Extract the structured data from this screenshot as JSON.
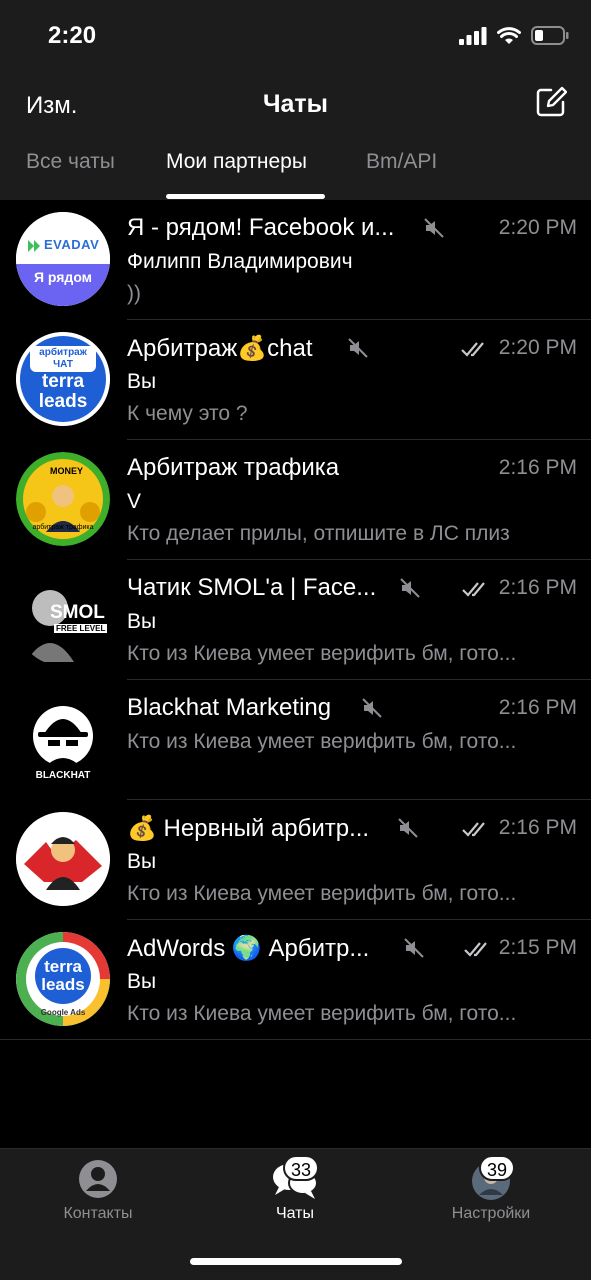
{
  "status": {
    "time": "2:20"
  },
  "nav": {
    "edit": "Изм.",
    "title": "Чаты"
  },
  "tabs": [
    {
      "label": "Все чаты"
    },
    {
      "label": "Мои партнеры"
    },
    {
      "label": "Bm/API"
    }
  ],
  "chats": [
    {
      "title": "Я - рядом! Facebook и...",
      "muted": true,
      "read": false,
      "time": "2:20 PM",
      "sender": "Филипп Владимирович",
      "message": "))",
      "avatar": {
        "text1": "EVADAV",
        "text2": "Я рядом"
      }
    },
    {
      "title": "Арбитраж💰chat",
      "muted": true,
      "read": true,
      "time": "2:20 PM",
      "sender": "Вы",
      "message": "К чему это ?",
      "avatar": {
        "text1": "арбитраж ЧАТ",
        "text2": "terra leads"
      }
    },
    {
      "title": "Арбитраж трафика",
      "muted": false,
      "read": false,
      "time": "2:16 PM",
      "sender": "V",
      "message": "Кто делает прилы, отпишите в ЛС плиз",
      "avatar": {
        "text1": "MONEY",
        "text2": "арбитраж трафика"
      }
    },
    {
      "title": "Чатик SMOL'a | Face...",
      "muted": true,
      "read": true,
      "time": "2:16 PM",
      "sender": "Вы",
      "message": "Кто из Киева умеет верифить бм, гото...",
      "avatar": {
        "text1": "SMOL",
        "text2": "FREE LEVEL"
      }
    },
    {
      "title": "Blackhat Marketing",
      "muted": true,
      "read": false,
      "time": "2:16 PM",
      "sender": "",
      "message": "Кто из Киева умеет верифить бм, гото...",
      "avatar": {
        "text1": "BLACKHAT",
        "text2": ""
      }
    },
    {
      "title": "💰 Нервный арбитр...",
      "muted": true,
      "read": true,
      "time": "2:16 PM",
      "sender": "Вы",
      "message": "Кто из Киева умеет верифить бм, гото...",
      "avatar": {
        "text1": "",
        "text2": ""
      }
    },
    {
      "title": "AdWords 🌍 Арбитр...",
      "muted": true,
      "read": true,
      "time": "2:15 PM",
      "sender": "Вы",
      "message": "Кто из Киева умеет верифить бм, гото...",
      "avatar": {
        "text1": "terra leads",
        "text2": "Google Ads"
      }
    }
  ],
  "tabbar": {
    "contacts": "Контакты",
    "chats": "Чаты",
    "chats_badge": "33",
    "settings": "Настройки",
    "settings_badge": "39"
  },
  "colors": {
    "accent": "#ffffff",
    "secondary": "#8e8e93",
    "background": "#000000",
    "bar": "#1c1c1d"
  }
}
